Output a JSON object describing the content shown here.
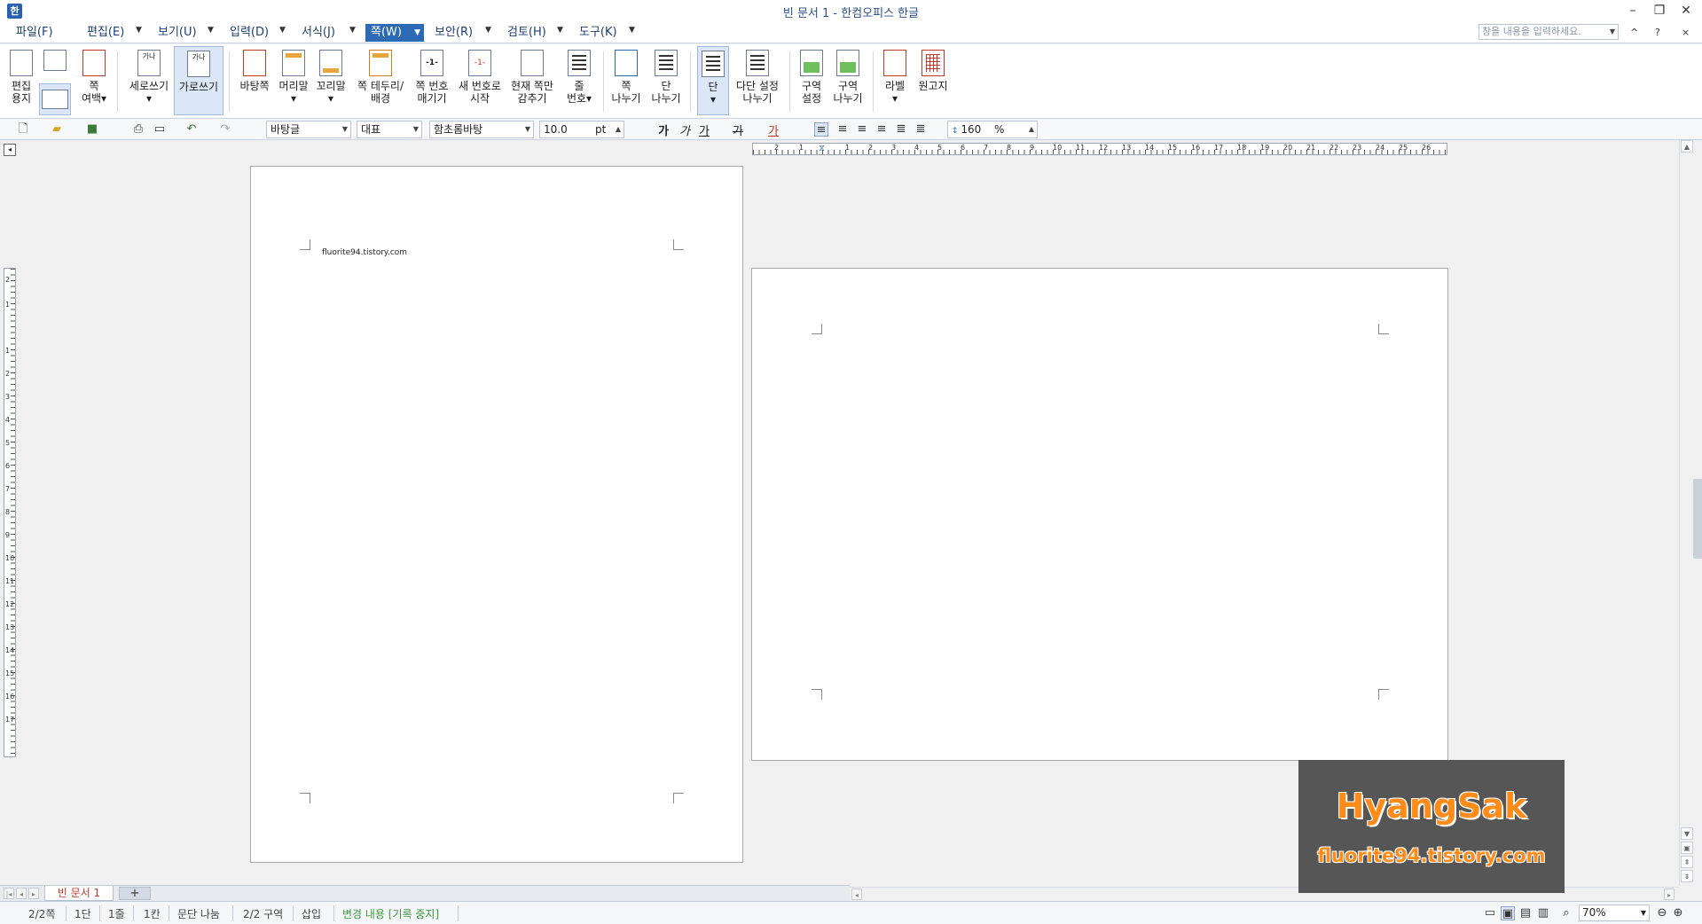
{
  "window": {
    "title": "빈 문서 1 - 한컴오피스 한글",
    "minimize_icon": "minimize-icon",
    "restore_icon": "restore-icon",
    "close_icon": "close-icon"
  },
  "menu": {
    "items": [
      {
        "label": "파일(F)"
      },
      {
        "label": "편집(E)"
      },
      {
        "label": "보기(U)"
      },
      {
        "label": "입력(D)"
      },
      {
        "label": "서식(J)"
      },
      {
        "label": "쪽(W)"
      },
      {
        "label": "보안(R)"
      },
      {
        "label": "검토(H)"
      },
      {
        "label": "도구(K)"
      }
    ],
    "active": "쪽(W)",
    "search_placeholder": "창을 내용을 입력하세요.",
    "collapse_label": "^",
    "help_label": "?",
    "pin_label": "×"
  },
  "ribbon": {
    "items": [
      {
        "label": "편집\n용지"
      },
      {
        "label": "쪽\n여백▾"
      },
      {
        "label": "세로쓰기\n▾"
      },
      {
        "label": "가로쓰기"
      },
      {
        "label": "바탕쪽"
      },
      {
        "label": "머리말\n▾"
      },
      {
        "label": "꼬리말\n▾"
      },
      {
        "label": "쪽 테두리/\n배경"
      },
      {
        "label": "쪽 번호\n매기기"
      },
      {
        "label": "새 번호로\n시작"
      },
      {
        "label": "현재 쪽만\n감추기"
      },
      {
        "label": "줄\n번호▾"
      },
      {
        "label": "쪽\n나누기"
      },
      {
        "label": "단\n나누기"
      },
      {
        "label": "단\n▾"
      },
      {
        "label": "다단 설정\n나누기"
      },
      {
        "label": "구역\n설정"
      },
      {
        "label": "구역\n나누기"
      },
      {
        "label": "라벨\n▾"
      },
      {
        "label": "원고지"
      }
    ],
    "icon_text_vertical": "가나",
    "icon_text_horizontal": "가나",
    "icon_page_number": "-1-"
  },
  "format_toolbar": {
    "style": "바탕글",
    "language": "대표",
    "font": "함초롬바탕",
    "font_size": "10.0",
    "font_unit": "pt",
    "char_bold": "가",
    "char_italic": "가",
    "char_underline": "가",
    "char_strike": "가",
    "char_color": "가",
    "line_spacing": "160",
    "line_spacing_unit": "%"
  },
  "ruler": {
    "h_numbers": [
      "2",
      "1",
      "1",
      "2",
      "3",
      "4",
      "5",
      "6",
      "7",
      "8",
      "9",
      "10",
      "11",
      "12",
      "13",
      "14",
      "15",
      "16",
      "17",
      "18",
      "19",
      "20",
      "21",
      "22",
      "23",
      "24",
      "25",
      "26"
    ],
    "v_numbers": [
      "2",
      "1",
      "1",
      "2",
      "3",
      "4",
      "5",
      "6",
      "7",
      "8",
      "9",
      "10",
      "11",
      "12",
      "13",
      "14",
      "15",
      "16",
      "17"
    ]
  },
  "document": {
    "page1_text": "fluorite94.tistory.com"
  },
  "tabs": {
    "doc_tab": "빈 문서 1",
    "add_tab": "+"
  },
  "status": {
    "page": "2/2쪽",
    "column": "1단",
    "line": "1줄",
    "col_pos": "1칸",
    "para_break": "문단 나눔",
    "section": "2/2 구역",
    "insert_mode": "삽입",
    "track_changes": "변경 내용 [기록 중지]",
    "zoom": "70%"
  },
  "watermark": {
    "title": "HyangSak",
    "url": "fluorite94.tistory.com"
  },
  "colors": {
    "accent": "#2c6ab5",
    "watermark_bg": "#565656",
    "watermark_text": "#ff8c1a",
    "track_changes": "#3d9a3d"
  }
}
